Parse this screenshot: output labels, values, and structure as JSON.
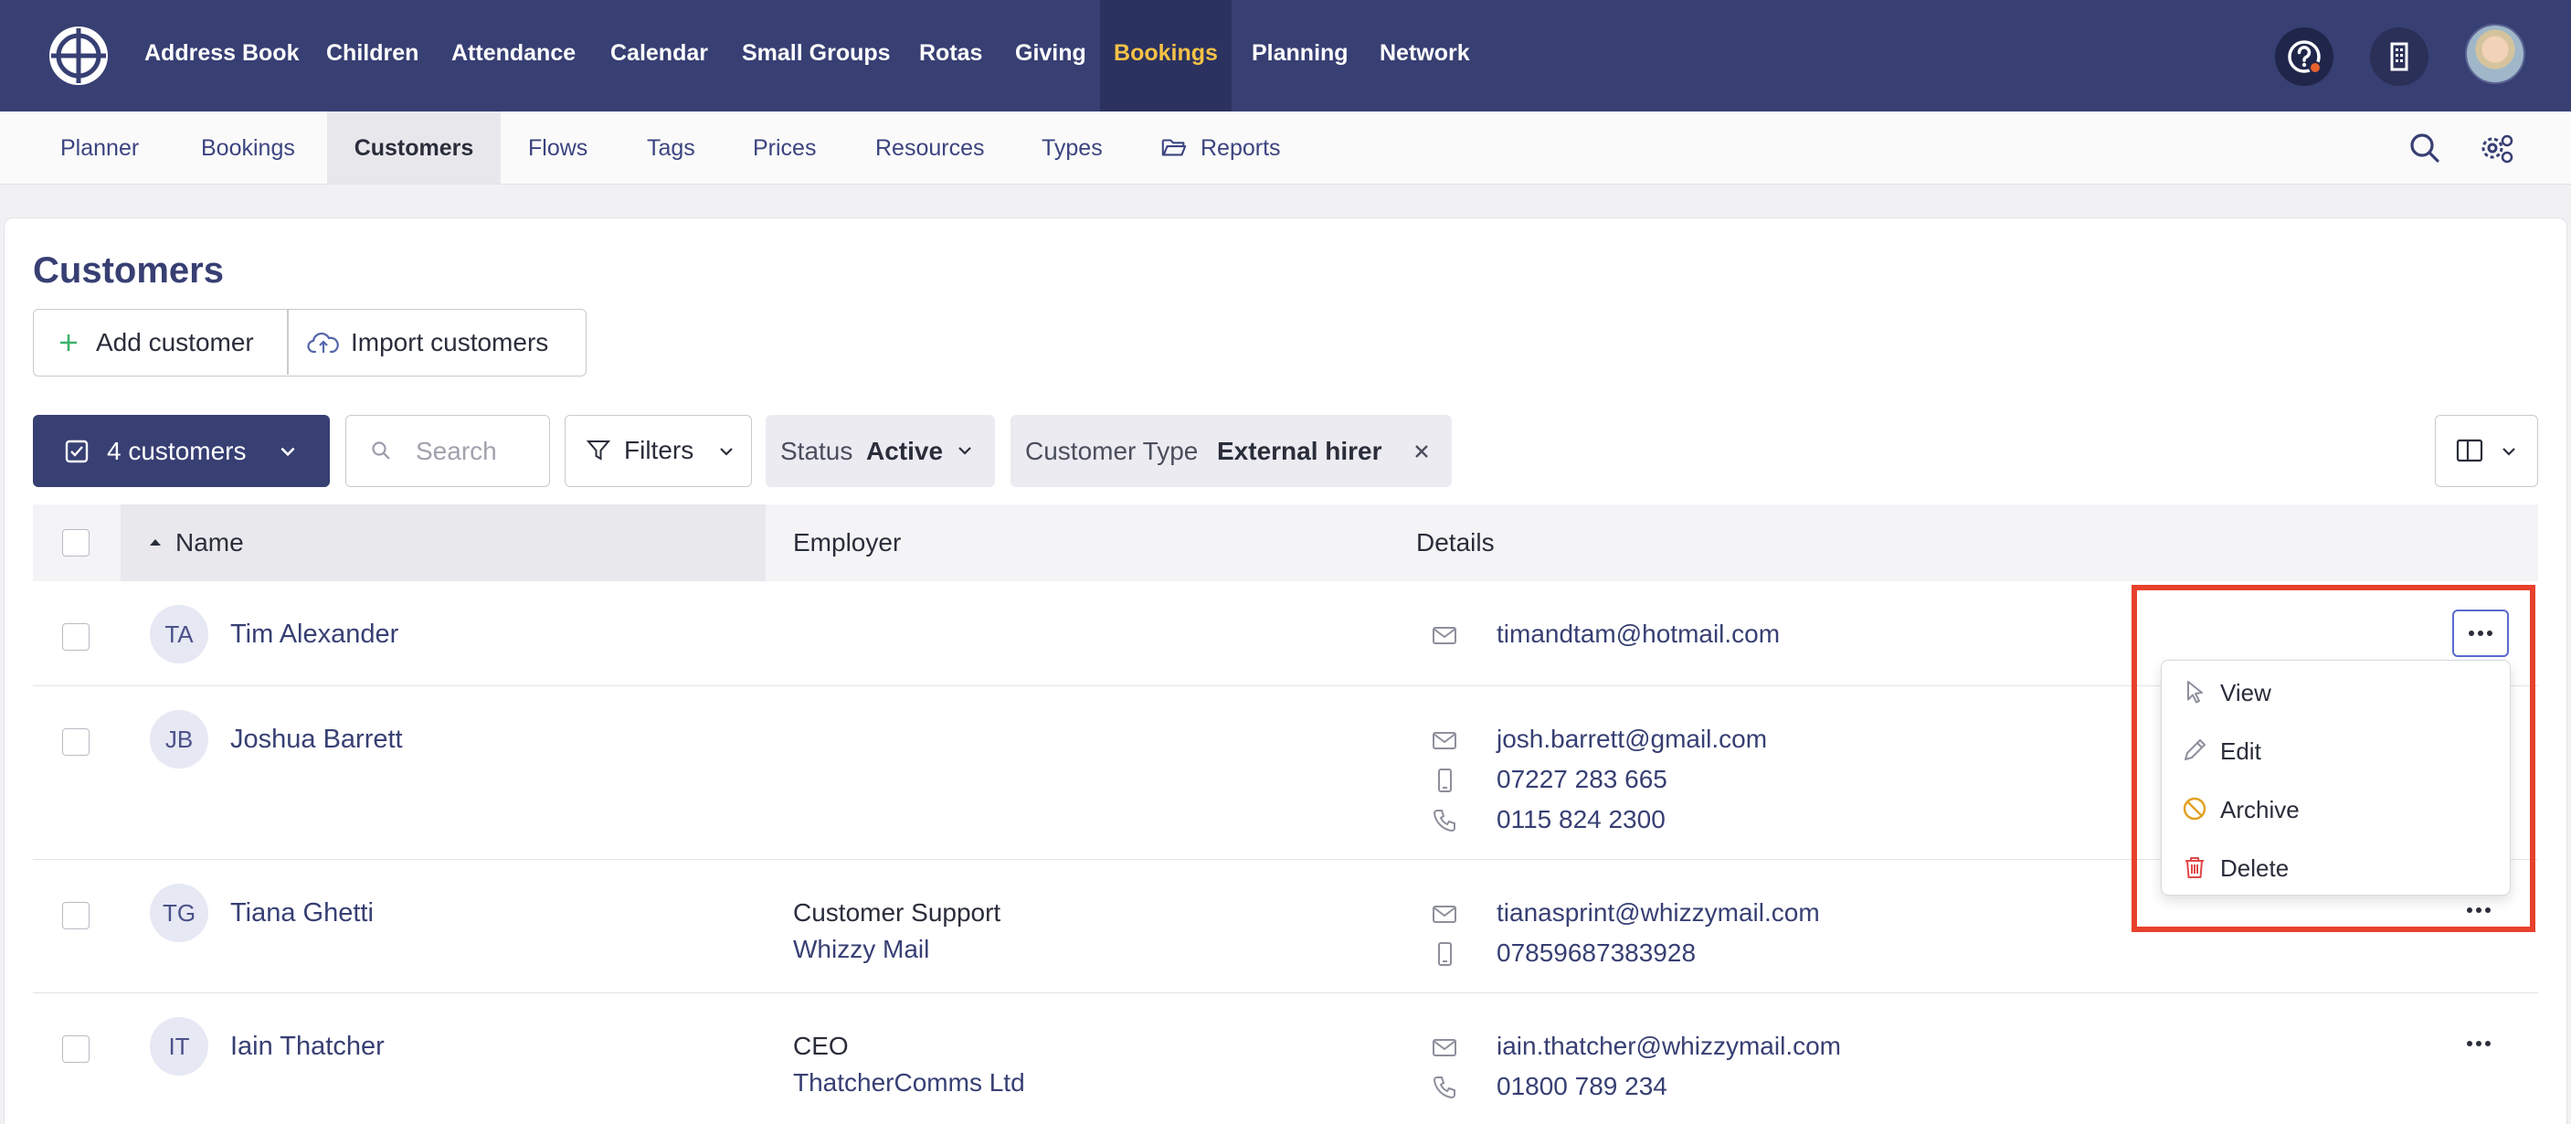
{
  "topnav": {
    "items": [
      "Address Book",
      "Children",
      "Attendance",
      "Calendar",
      "Small Groups",
      "Rotas",
      "Giving",
      "Bookings",
      "Planning",
      "Network"
    ],
    "active": "Bookings",
    "colors": {
      "bar": "#373f73",
      "active_text": "#f5c246"
    }
  },
  "subnav": {
    "items": [
      "Planner",
      "Bookings",
      "Customers",
      "Flows",
      "Tags",
      "Prices",
      "Resources",
      "Types",
      "Reports"
    ],
    "active": "Customers"
  },
  "page": {
    "title": "Customers",
    "add_label": "Add customer",
    "import_label": "Import customers"
  },
  "toolbar": {
    "selection_label": "4 customers",
    "search_placeholder": "Search",
    "filters_label": "Filters",
    "status_key": "Status",
    "status_value": "Active",
    "type_key": "Customer Type",
    "type_value": "External hirer"
  },
  "table": {
    "headers": [
      "Name",
      "Employer",
      "Details"
    ],
    "rows": [
      {
        "initials": "TA",
        "name": "Tim Alexander",
        "email": "timandtam@hotmail.com"
      },
      {
        "initials": "JB",
        "name": "Joshua Barrett",
        "email": "josh.barrett@gmail.com",
        "mobile": "07227 283 665",
        "phone": "0115 824 2300"
      },
      {
        "initials": "TG",
        "name": "Tiana Ghetti",
        "role": "Customer Support",
        "company": "Whizzy Mail",
        "email": "tianasprint@whizzymail.com",
        "mobile": "07859687383928"
      },
      {
        "initials": "IT",
        "name": "Iain Thatcher",
        "role": "CEO",
        "company": "ThatcherComms Ltd",
        "email": "iain.thatcher@whizzymail.com",
        "phone": "01800 789 234"
      }
    ]
  },
  "row_menu": {
    "items": [
      "View",
      "Edit",
      "Archive",
      "Delete"
    ],
    "colors": {
      "archive": "#e0a020",
      "delete": "#e04848",
      "highlight": "#e8412c"
    }
  }
}
